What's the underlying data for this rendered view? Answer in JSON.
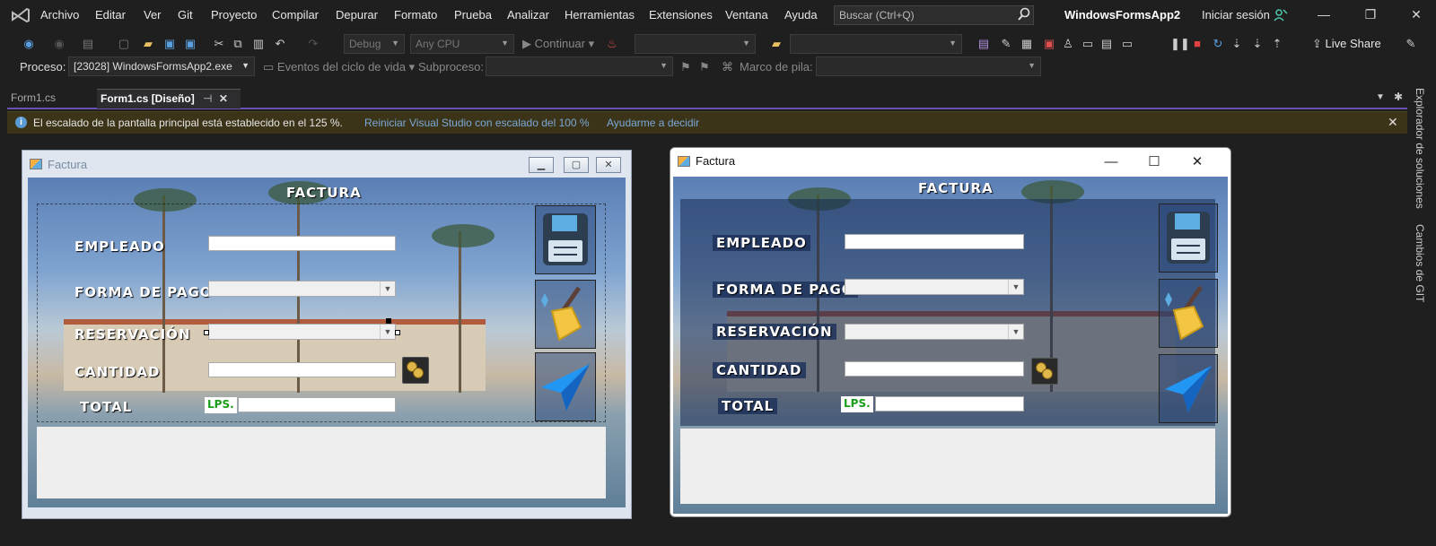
{
  "menubar": {
    "items": [
      "Archivo",
      "Editar",
      "Ver",
      "Git",
      "Proyecto",
      "Compilar",
      "Depurar",
      "Formato",
      "Prueba",
      "Analizar",
      "Herramientas",
      "Extensiones",
      "Ventana",
      "Ayuda"
    ],
    "search_placeholder": "Buscar (Ctrl+Q)",
    "solution_name": "WindowsFormsApp2",
    "signin": "Iniciar sesión"
  },
  "toolbar": {
    "config": "Debug",
    "platform": "Any CPU",
    "continue": "Continuar",
    "liveshare": "Live Share"
  },
  "procbar": {
    "process_label": "Proceso:",
    "process_value": "[23028] WindowsFormsApp2.exe",
    "lifecycle": "Eventos del ciclo de vida",
    "subprocess": "Subproceso:",
    "stack": "Marco de pila:"
  },
  "tabs": {
    "tab1": "Form1.cs",
    "tab2": "Form1.cs [Diseño]"
  },
  "infobar": {
    "text": "El escalado de la pantalla principal está establecido en el 125 %.",
    "link1": "Reiniciar Visual Studio con escalado del 100 %",
    "link2": "Ayudarme a decidir"
  },
  "sidepanel": {
    "solution_explorer": "Explorador de soluciones",
    "git_changes": "Cambios de GIT"
  },
  "form": {
    "title": "Factura",
    "heading": "FACTURA",
    "labels": {
      "empleado": "EMPLEADO",
      "forma_pago": "FORMA DE PAGO",
      "reservacion": "RESERVACIÓN",
      "cantidad": "CANTIDAD",
      "total": "TOTAL"
    },
    "currency": "LPS."
  },
  "colors": {
    "accent": "#6c4fb3",
    "infobar_bg": "#3c3418",
    "link": "#7aa8d8",
    "lps_green": "#1a9e1a"
  }
}
